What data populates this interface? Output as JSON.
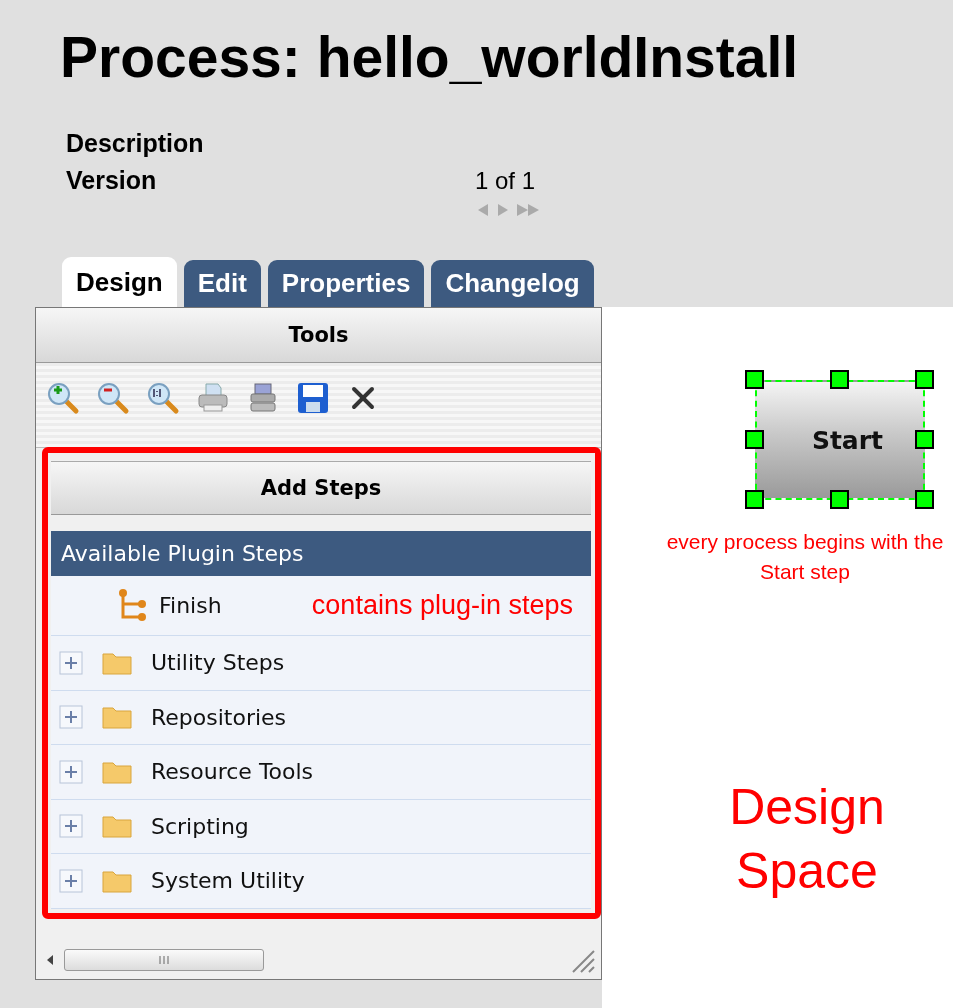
{
  "process": {
    "title": "Process: hello_worldInstall",
    "fields": [
      {
        "label": "Description"
      },
      {
        "label": "Version",
        "value": "1 of 1"
      }
    ]
  },
  "tabs": [
    {
      "label": "Design",
      "selected": true
    },
    {
      "label": "Edit",
      "selected": false
    },
    {
      "label": "Properties",
      "selected": false
    },
    {
      "label": "Changelog",
      "selected": false
    }
  ],
  "tools_panel": {
    "title": "Tools"
  },
  "steps_panel": {
    "title": "Add Steps",
    "tree": {
      "label": "Available Plugin Steps",
      "children": [
        {
          "label": "Finish",
          "kind": "step"
        },
        {
          "label": "Utility Steps",
          "kind": "folder",
          "expanded": false
        },
        {
          "label": "Repositories",
          "kind": "folder",
          "expanded": false
        },
        {
          "label": "Resource Tools",
          "kind": "folder",
          "expanded": false
        },
        {
          "label": "Scripting",
          "kind": "folder",
          "expanded": false
        },
        {
          "label": "System Utility",
          "kind": "folder",
          "expanded": false
        }
      ]
    }
  },
  "canvas": {
    "node": {
      "label": "Start",
      "selected": true
    }
  },
  "annotations": {
    "steps_note": "contains plug-in steps",
    "start_note": "every process begins with the Start step",
    "design_space": "Design Space"
  }
}
